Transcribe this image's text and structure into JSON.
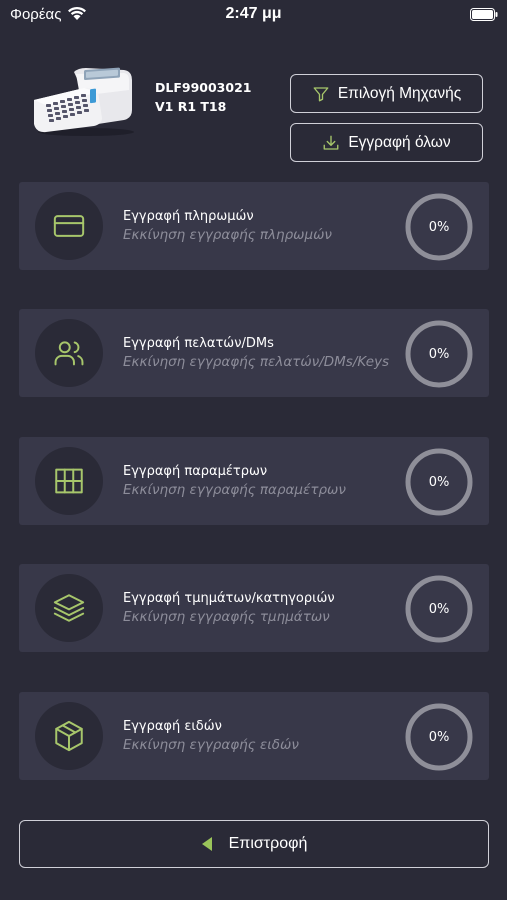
{
  "status_bar": {
    "carrier": "Φορέας",
    "time": "2:47 μμ"
  },
  "device": {
    "serial": "DLF99003021",
    "version": "V1 R1 T18"
  },
  "buttons": {
    "select_machine": "Επιλογή Μηχανής",
    "write_all": "Εγγραφή όλων",
    "back": "Επιστροφή"
  },
  "colors": {
    "background": "#2a2a37",
    "card": "#383849",
    "icon_accent": "#a7c66b",
    "back_arrow": "#9ac45a",
    "ring": "#8f8f99"
  },
  "tasks": [
    {
      "icon": "credit-card-icon",
      "title": "Εγγραφή πληρωμών",
      "subtitle": "Εκκίνηση εγγραφής πληρωμών",
      "progress": "0%"
    },
    {
      "icon": "users-icon",
      "title": "Εγγραφή πελατών/DMs",
      "subtitle": "Εκκίνηση εγγραφής πελατών/DMs/Keys",
      "progress": "0%"
    },
    {
      "icon": "grid-icon",
      "title": "Εγγραφή παραμέτρων",
      "subtitle": "Εκκίνηση εγγραφής παραμέτρων",
      "progress": "0%"
    },
    {
      "icon": "layers-icon",
      "title": "Εγγραφή τμημάτων/κατηγοριών",
      "subtitle": "Εκκίνηση εγγραφής τμημάτων",
      "progress": "0%"
    },
    {
      "icon": "box-icon",
      "title": "Εγγραφή ειδών",
      "subtitle": "Εκκίνηση εγγραφής ειδών",
      "progress": "0%"
    }
  ]
}
